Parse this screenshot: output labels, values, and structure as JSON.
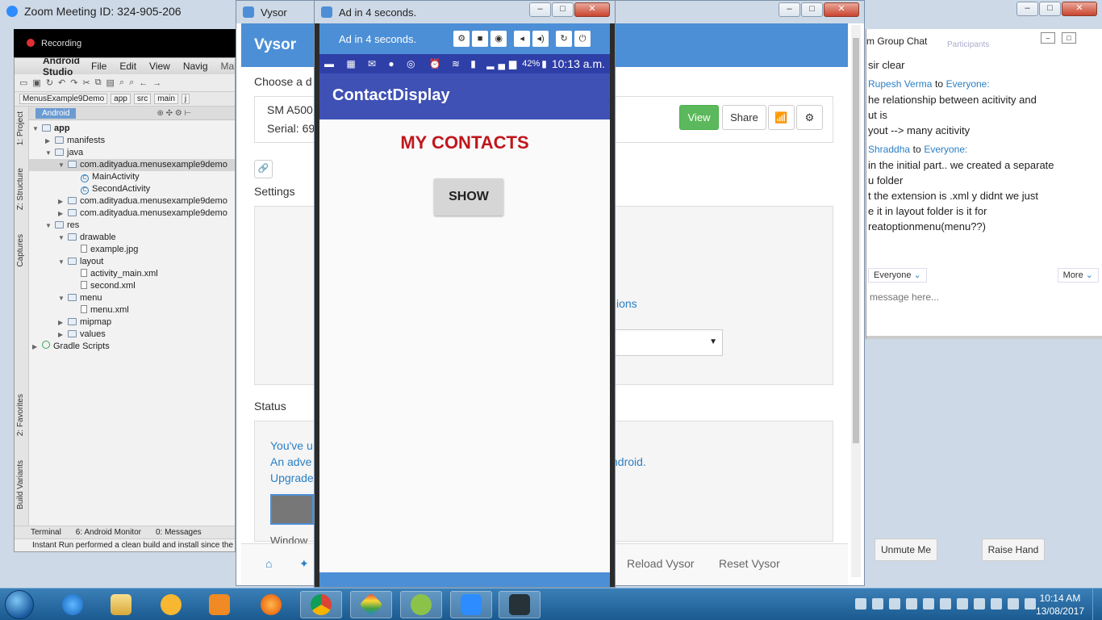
{
  "zoom": {
    "title": "Zoom Meeting ID: 324-905-206",
    "recording": "Recording",
    "chat_title": "m Group Chat",
    "participants_tab": "Participants",
    "messages": [
      {
        "type": "text",
        "text": "sir clear"
      },
      {
        "type": "sender",
        "from": "Rupesh Verma",
        "to_word": "to",
        "to": "Everyone:"
      },
      {
        "type": "text",
        "text": "he relationship between acitivity and"
      },
      {
        "type": "text",
        "text": "ut is"
      },
      {
        "type": "text",
        "text": "yout --> many acitivity"
      },
      {
        "type": "sender",
        "from": "Shraddha",
        "to_word": "to",
        "to": "Everyone:"
      },
      {
        "type": "text",
        "text": "in the initial part.. we created a separate"
      },
      {
        "type": "text",
        "text": "u folder"
      },
      {
        "type": "text",
        "text": "t the extension is .xml y didnt we just"
      },
      {
        "type": "text",
        "text": "e it in layout folder is it for"
      },
      {
        "type": "text",
        "text": "reatoptionmenu(menu??)"
      }
    ],
    "to_select": "Everyone",
    "more_label": "More",
    "message_placeholder": "message here...",
    "unmute_label": "Unmute Me",
    "raise_hand_label": "Raise Hand"
  },
  "studio": {
    "app_name": "Android Studio",
    "menu": [
      "File",
      "Edit",
      "View",
      "Navig"
    ],
    "tab_file": "MainAc",
    "breadcrumb": [
      "MenusExample9Demo",
      "app",
      "src",
      "main",
      "j"
    ],
    "view_selector": "Android",
    "side_tabs": [
      "1: Project",
      "Z: Structure",
      "Captures",
      "2: Favorites",
      "Build Variants"
    ],
    "tree": [
      {
        "depth": 0,
        "icon": "folder",
        "label": "app",
        "bold": true,
        "arrow": "▼"
      },
      {
        "depth": 1,
        "icon": "folder",
        "label": "manifests",
        "arrow": "▶"
      },
      {
        "depth": 1,
        "icon": "folder",
        "label": "java",
        "arrow": "▼"
      },
      {
        "depth": 2,
        "icon": "folder",
        "label": "com.adityadua.menusexample9demo",
        "arrow": "▼",
        "selected": true
      },
      {
        "depth": 3,
        "icon": "class",
        "label": "MainActivity",
        "arrow": ""
      },
      {
        "depth": 3,
        "icon": "class",
        "label": "SecondActivity",
        "arrow": ""
      },
      {
        "depth": 2,
        "icon": "folder",
        "label": "com.adityadua.menusexample9demo",
        "arrow": "▶"
      },
      {
        "depth": 2,
        "icon": "folder",
        "label": "com.adityadua.menusexample9demo",
        "arrow": "▶"
      },
      {
        "depth": 1,
        "icon": "folder",
        "label": "res",
        "arrow": "▼"
      },
      {
        "depth": 2,
        "icon": "folder",
        "label": "drawable",
        "arrow": "▼"
      },
      {
        "depth": 3,
        "icon": "file",
        "label": "example.jpg",
        "arrow": ""
      },
      {
        "depth": 2,
        "icon": "folder",
        "label": "layout",
        "arrow": "▼"
      },
      {
        "depth": 3,
        "icon": "file",
        "label": "activity_main.xml",
        "arrow": ""
      },
      {
        "depth": 3,
        "icon": "file",
        "label": "second.xml",
        "arrow": ""
      },
      {
        "depth": 2,
        "icon": "folder",
        "label": "menu",
        "arrow": "▼"
      },
      {
        "depth": 3,
        "icon": "file",
        "label": "menu.xml",
        "arrow": ""
      },
      {
        "depth": 2,
        "icon": "folder",
        "label": "mipmap",
        "arrow": "▶"
      },
      {
        "depth": 2,
        "icon": "folder",
        "label": "values",
        "arrow": "▶"
      },
      {
        "depth": 0,
        "icon": "gradle",
        "label": "Gradle Scripts",
        "arrow": "▶"
      }
    ],
    "bottom_tabs": [
      "Terminal",
      "6: Android Monitor",
      "0: Messages"
    ],
    "status": "Instant Run performed a clean build and install since the ins"
  },
  "vysor": {
    "title": "Vysor",
    "brand": "Vysor",
    "choose_label": "Choose a d",
    "device_name": "SM A500",
    "serial": "Serial: 69",
    "view_label": "View",
    "share_label": "Share",
    "settings_label": "Settings",
    "options_link": "ions",
    "status_label": "Status",
    "status_line1": "You've u",
    "status_line2": "An adve",
    "status_line2_end": "ndroid.",
    "status_line3": "Upgrade",
    "windows_text": "Window",
    "reload_label": "Reload Vysor",
    "reset_label": "Reset Vysor"
  },
  "device": {
    "title": "Ad in 4 seconds.",
    "bar_text": "Ad in 4 seconds.",
    "battery": "42%",
    "time": "10:13 a.m.",
    "app_title": "ContactDisplay",
    "heading": "MY CONTACTS",
    "button": "SHOW"
  },
  "taskbar": {
    "time": "10:14 AM",
    "date": "13/08/2017"
  },
  "colors": {
    "vysor_blue": "#4c8fd6",
    "appbar": "#3f51b5",
    "heading_red": "#c0161c",
    "view_green": "#5cb85c"
  }
}
